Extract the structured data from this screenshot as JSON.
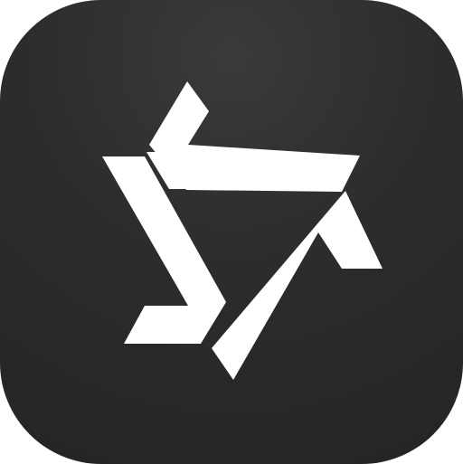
{
  "icon": {
    "name": "app-icon-rounded-square",
    "background_color": "#2c2c2c",
    "glyph_color": "#ffffff",
    "glyph_icon": "interlocking-hexagram-logo-icon"
  }
}
